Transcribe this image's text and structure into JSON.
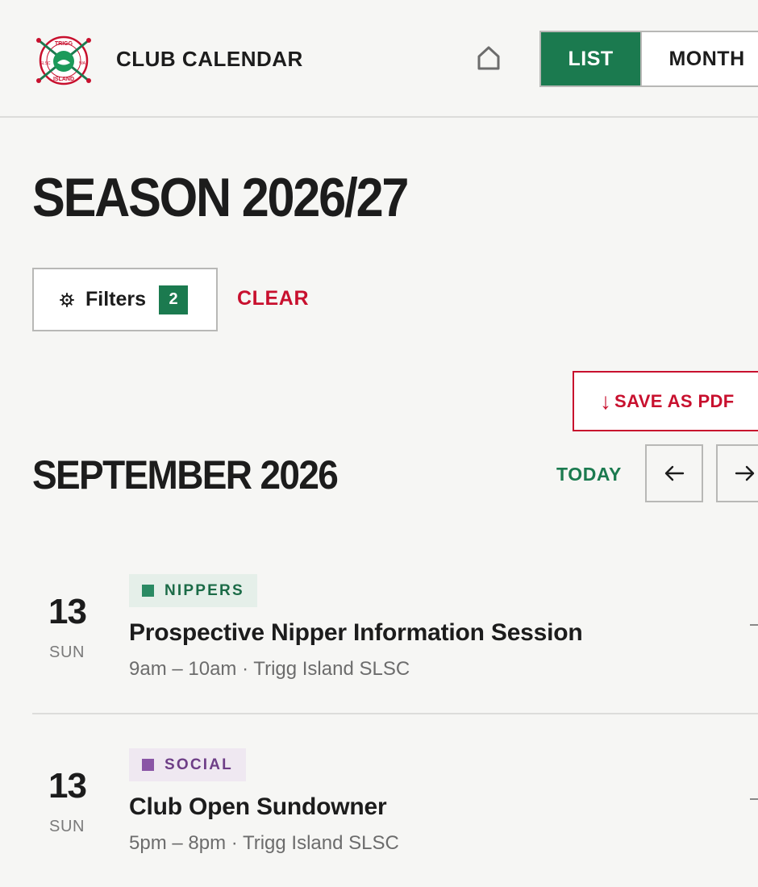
{
  "header": {
    "logo": {
      "top_text": "TRIGG",
      "bottom_text": "ISLAND",
      "left_text": "SLSC",
      "right_text": "WA"
    },
    "title": "CLUB CALENDAR",
    "home_icon": "home-icon",
    "views": {
      "list_label": "LIST",
      "month_label": "MONTH",
      "active": "LIST"
    }
  },
  "season": {
    "title": "SEASON 2026/27"
  },
  "filters": {
    "label": "Filters",
    "icon": "gear-icon",
    "count": "2",
    "clear_label": "CLEAR"
  },
  "pdf": {
    "arrow": "↓",
    "label": "SAVE AS PDF"
  },
  "month": {
    "title": "SEPTEMBER 2026",
    "today_label": "TODAY",
    "prev_icon": "arrow-left-icon",
    "next_icon": "arrow-right-icon"
  },
  "events": [
    {
      "day_num": "13",
      "day_name": "SUN",
      "tag": "NIPPERS",
      "tag_color": "#2a8a63",
      "title": "Prospective Nipper Information Session",
      "meta": "9am – 10am · Trigg Island SLSC"
    },
    {
      "day_num": "13",
      "day_name": "SUN",
      "tag": "SOCIAL",
      "tag_color": "#8a55a6",
      "title": "Club Open Sundowner",
      "meta": "5pm – 8pm · Trigg Island SLSC"
    }
  ],
  "colors": {
    "brand_green": "#1b7a4f",
    "accent_red": "#c8102e",
    "background": "#f6f6f4"
  }
}
